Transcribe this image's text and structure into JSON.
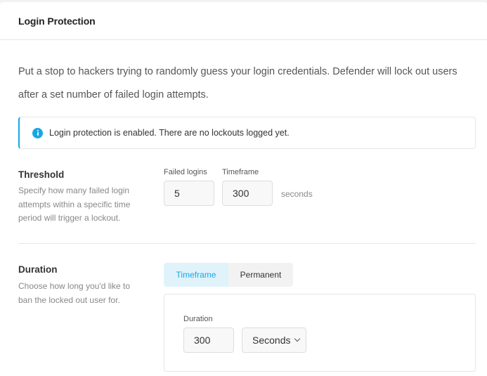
{
  "header": {
    "title": "Login Protection"
  },
  "intro": "Put a stop to hackers trying to randomly guess your login credentials. Defender will lock out users after a set number of failed login attempts.",
  "notice": {
    "text": "Login protection is enabled. There are no lockouts logged yet.",
    "icon": "info-icon",
    "accent_color": "#17a8e3"
  },
  "threshold": {
    "title": "Threshold",
    "description": "Specify how many failed login attempts within a specific time period will trigger a lockout.",
    "failed_logins_label": "Failed logins",
    "failed_logins_value": "5",
    "timeframe_label": "Timeframe",
    "timeframe_value": "300",
    "unit": "seconds"
  },
  "duration": {
    "title": "Duration",
    "description": "Choose how long you'd like to ban the locked out user for.",
    "tabs": [
      {
        "label": "Timeframe",
        "active": true
      },
      {
        "label": "Permanent",
        "active": false
      }
    ],
    "field_label": "Duration",
    "value": "300",
    "unit_select": "Seconds"
  }
}
